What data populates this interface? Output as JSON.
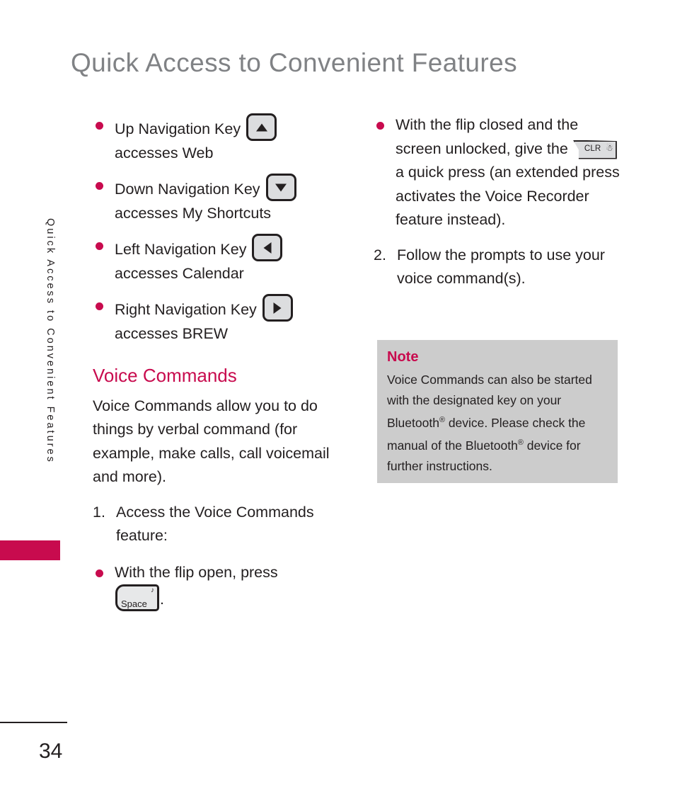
{
  "page": {
    "title": "Quick Access to Convenient Features",
    "running_head": "Quick Access to Convenient Features",
    "page_number": "34",
    "accent_color": "#c80b4e",
    "title_color": "#808285",
    "note_bg_color": "#cccccc",
    "key_fill_color": "#dcdddf"
  },
  "left_column": {
    "nav_bullets": [
      {
        "text_before": "Up Navigation Key",
        "key_icon": "nav-key-up-icon",
        "text_after": "accesses Web"
      },
      {
        "text_before": "Down Navigation Key",
        "key_icon": "nav-key-down-icon",
        "text_after": "accesses My Shortcuts"
      },
      {
        "text_before": "Left Navigation Key",
        "key_icon": "nav-key-left-icon",
        "text_after": "accesses Calendar"
      },
      {
        "text_before": "Right Navigation Key",
        "key_icon": "nav-key-right-icon",
        "text_after": "accesses BREW"
      }
    ],
    "section_heading": "Voice Commands",
    "body_paragraph": "Voice Commands allow you to do things by verbal command (for example, make calls, call voicemail and more).",
    "step_1": {
      "number": "1.",
      "text": "Access the Voice Commands feature:"
    },
    "flip_open_bullet": {
      "text_before": "With the flip open, press",
      "key_label": "Space",
      "key_mini_icon": "speaker-note-icon",
      "text_after": "."
    }
  },
  "right_column": {
    "flip_closed_bullet": {
      "part_1": "With the flip closed and the screen unlocked, give the",
      "key_label": "CLR",
      "key_mic_icon": "microphone-icon",
      "part_2": "a quick press (an extended press activates the Voice Recorder feature instead)."
    },
    "step_2": {
      "number": "2.",
      "text": "Follow the prompts to use your voice command(s)."
    },
    "note": {
      "title": "Note",
      "line_1": "Voice Commands can also be started with the designated key on your Bluetooth",
      "sup_1": "®",
      "line_2": " device. Please check the manual of the Bluetooth",
      "sup_2": "®",
      "line_3": " device for further instructions."
    }
  }
}
